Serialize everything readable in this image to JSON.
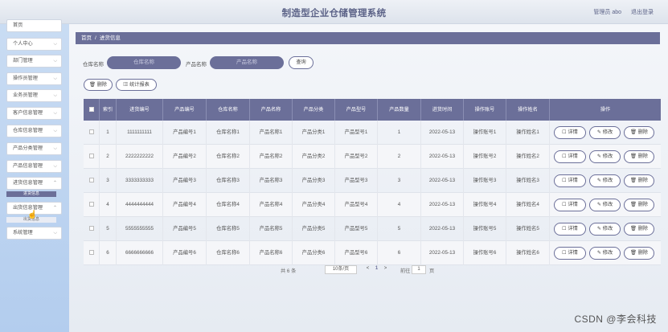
{
  "header": {
    "title": "制造型企业仓储管理系统",
    "admin_label": "管理员 abo",
    "logout_label": "退出登录"
  },
  "sidebar": {
    "items": [
      {
        "label": "首页"
      },
      {
        "label": "个人中心"
      },
      {
        "label": "部门管理"
      },
      {
        "label": "操作员管理"
      },
      {
        "label": "业务员管理"
      },
      {
        "label": "客户信息管理"
      },
      {
        "label": "仓库信息管理"
      },
      {
        "label": "产品分类管理"
      },
      {
        "label": "产品信息管理"
      },
      {
        "label": "进货信息管理"
      },
      {
        "label": "出货信息管理"
      },
      {
        "label": "系统管理"
      }
    ],
    "sub_purchase": "进货信息",
    "sub_shipment": "出货信息"
  },
  "breadcrumb": {
    "home": "首页",
    "separator": "/",
    "current": "进货信息"
  },
  "search": {
    "warehouse_label": "仓库名称",
    "warehouse_placeholder": "仓库名称",
    "product_label": "产品名称",
    "product_placeholder": "产品名称",
    "query_button": "查询"
  },
  "toolbar": {
    "delete_button": "删除",
    "stats_button": "统计报表"
  },
  "table": {
    "columns": [
      "索引",
      "进货编号",
      "产品编号",
      "仓库名称",
      "产品名称",
      "产品分类",
      "产品型号",
      "产品数量",
      "进货时间",
      "操作账号",
      "操作姓名",
      "操作"
    ],
    "rows": [
      {
        "index": "1",
        "purchase_no": "1111111111",
        "product_no": "产品编号1",
        "warehouse": "仓库名称1",
        "product_name": "产品名称1",
        "category": "产品分类1",
        "model": "产品型号1",
        "quantity": "1",
        "date": "2022-05-13",
        "account": "操作账号1",
        "operator": "操作姓名1"
      },
      {
        "index": "2",
        "purchase_no": "2222222222",
        "product_no": "产品编号2",
        "warehouse": "仓库名称2",
        "product_name": "产品名称2",
        "category": "产品分类2",
        "model": "产品型号2",
        "quantity": "2",
        "date": "2022-05-13",
        "account": "操作账号2",
        "operator": "操作姓名2"
      },
      {
        "index": "3",
        "purchase_no": "3333333333",
        "product_no": "产品编号3",
        "warehouse": "仓库名称3",
        "product_name": "产品名称3",
        "category": "产品分类3",
        "model": "产品型号3",
        "quantity": "3",
        "date": "2022-05-13",
        "account": "操作账号3",
        "operator": "操作姓名3"
      },
      {
        "index": "4",
        "purchase_no": "4444444444",
        "product_no": "产品编号4",
        "warehouse": "仓库名称4",
        "product_name": "产品名称4",
        "category": "产品分类4",
        "model": "产品型号4",
        "quantity": "4",
        "date": "2022-05-13",
        "account": "操作账号4",
        "operator": "操作姓名4"
      },
      {
        "index": "5",
        "purchase_no": "5555555555",
        "product_no": "产品编号5",
        "warehouse": "仓库名称5",
        "product_name": "产品名称5",
        "category": "产品分类5",
        "model": "产品型号5",
        "quantity": "5",
        "date": "2022-05-13",
        "account": "操作账号5",
        "operator": "操作姓名5"
      },
      {
        "index": "6",
        "purchase_no": "6666666666",
        "product_no": "产品编号6",
        "warehouse": "仓库名称6",
        "product_name": "产品名称6",
        "category": "产品分类6",
        "model": "产品型号6",
        "quantity": "6",
        "date": "2022-05-13",
        "account": "操作账号6",
        "operator": "操作姓名6"
      }
    ],
    "action_detail": "详情",
    "action_edit": "修改",
    "action_delete": "删除"
  },
  "pagination": {
    "total": "共 6 条",
    "page_size": "10条/页",
    "prev": "<",
    "current_page": "1",
    "next": ">",
    "goto_label": "前往",
    "goto_value": "1",
    "page_suffix": "页"
  },
  "watermark": "CSDN @李会科技",
  "colors": {
    "accent": "#6b6f99",
    "sidebar_bg": "#c9dcf3",
    "title_text": "#5b6287"
  }
}
